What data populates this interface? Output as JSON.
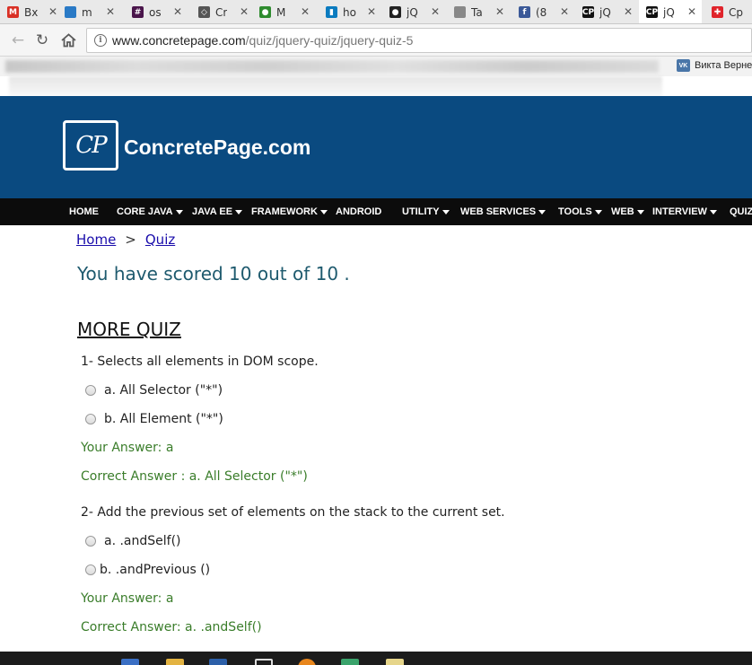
{
  "browser": {
    "tabs": [
      {
        "label": "Вх",
        "icon": "gmail-icon",
        "color": "#d93025",
        "glyph": "M"
      },
      {
        "label": "m",
        "icon": "bookmark-icon",
        "color": "#2a7ac6",
        "glyph": ""
      },
      {
        "label": "os",
        "icon": "slack-icon",
        "color": "#4a154b",
        "glyph": "#"
      },
      {
        "label": "Cr",
        "icon": "codepen-icon",
        "color": "#555555",
        "glyph": "◇"
      },
      {
        "label": "M",
        "icon": "green-dot-icon",
        "color": "#2e8b2e",
        "glyph": "●"
      },
      {
        "label": "ho",
        "icon": "trello-icon",
        "color": "#0a7bbf",
        "glyph": "▮"
      },
      {
        "label": "jQ",
        "icon": "github-icon",
        "color": "#222222",
        "glyph": "●"
      },
      {
        "label": "Ta",
        "icon": "document-icon",
        "color": "#888888",
        "glyph": ""
      },
      {
        "label": "(8",
        "icon": "facebook-icon",
        "color": "#3b5998",
        "glyph": "f"
      },
      {
        "label": "jQ",
        "icon": "concretepage-icon",
        "color": "#111111",
        "glyph": "CP"
      },
      {
        "label": "jQ",
        "icon": "concretepage-icon",
        "color": "#111111",
        "glyph": "CP"
      },
      {
        "label": "Cp",
        "icon": "lifebuoy-icon",
        "color": "#e0242b",
        "glyph": "✚"
      }
    ],
    "url_domain": "www.concretepage.com",
    "url_path": "/quiz/jquery-quiz/jquery-quiz-5",
    "bookmark_visible": "Викта Верне"
  },
  "site": {
    "logo_mark": "CP",
    "name": "ConcretePage.com"
  },
  "menu": [
    {
      "label": "HOME",
      "dropdown": false
    },
    {
      "label": "CORE JAVA",
      "dropdown": true
    },
    {
      "label": "JAVA EE",
      "dropdown": true
    },
    {
      "label": "FRAMEWORK",
      "dropdown": true
    },
    {
      "label": "ANDROID",
      "dropdown": false
    },
    {
      "label": "UTILITY",
      "dropdown": true
    },
    {
      "label": "WEB SERVICES",
      "dropdown": true
    },
    {
      "label": "TOOLS",
      "dropdown": true
    },
    {
      "label": "WEB",
      "dropdown": true
    },
    {
      "label": "INTERVIEW",
      "dropdown": true
    },
    {
      "label": "QUIZ",
      "dropdown": false
    }
  ],
  "breadcrumb": {
    "home": "Home",
    "separator": ">",
    "current": "Quiz"
  },
  "score_text": "You have scored 10 out of 10 .",
  "more_quiz": "MORE QUIZ",
  "questions": [
    {
      "text": "1- Selects all elements in DOM scope.",
      "options": [
        "a. All Selector (\"*\")",
        "b. All Element (\"*\")"
      ],
      "your_answer": "Your Answer: a",
      "correct_answer": "Correct Answer : a. All Selector (\"*\")"
    },
    {
      "text": "2- Add the previous set of elements on the stack to the current set.",
      "options": [
        "a. .andSelf()",
        "b. .andPrevious ()"
      ],
      "your_answer": "Your Answer: a",
      "correct_answer": "Correct Answer: a. .andSelf()"
    }
  ],
  "colors": {
    "header_bg": "#0a4a80",
    "menu_bg": "#0c0c0c",
    "score_text": "#1e5a6e",
    "answer_text": "#3a7d2a",
    "link": "#1a0dab"
  }
}
